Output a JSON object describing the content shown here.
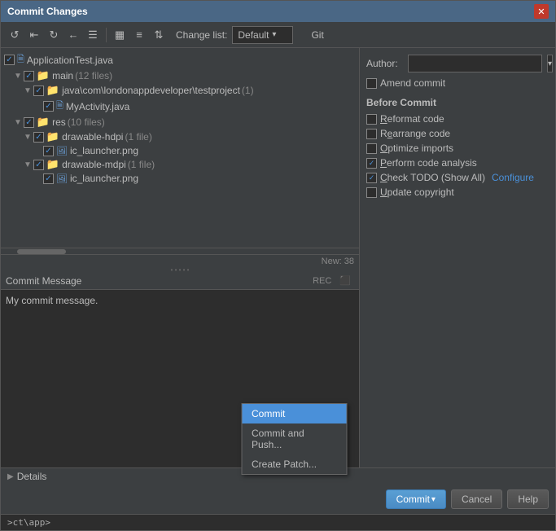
{
  "dialog": {
    "title": "Commit Changes"
  },
  "toolbar": {
    "changelist_label": "Change list:",
    "changelist_value": "Default",
    "git_tab": "Git"
  },
  "file_tree": {
    "items": [
      {
        "id": 1,
        "indent": 0,
        "type": "file",
        "checked": true,
        "name": "ApplicationTest.java",
        "count": ""
      },
      {
        "id": 2,
        "indent": 1,
        "type": "folder",
        "checked": true,
        "name": "main",
        "count": "(12 files)",
        "collapsed": false
      },
      {
        "id": 3,
        "indent": 2,
        "type": "folder",
        "checked": true,
        "name": "java\\com\\londonappdeveloper\\testproject",
        "count": "(1)",
        "collapsed": false
      },
      {
        "id": 4,
        "indent": 3,
        "type": "file",
        "checked": true,
        "name": "MyActivity.java",
        "count": ""
      },
      {
        "id": 5,
        "indent": 1,
        "type": "folder",
        "checked": true,
        "name": "res",
        "count": "(10 files)",
        "collapsed": false
      },
      {
        "id": 6,
        "indent": 2,
        "type": "folder",
        "checked": true,
        "name": "drawable-hdpi",
        "count": "(1 file)",
        "collapsed": false
      },
      {
        "id": 7,
        "indent": 3,
        "type": "file",
        "checked": true,
        "name": "ic_launcher.png",
        "count": ""
      },
      {
        "id": 8,
        "indent": 2,
        "type": "folder",
        "checked": true,
        "name": "drawable-mdpi",
        "count": "(1 file)",
        "collapsed": false
      },
      {
        "id": 9,
        "indent": 3,
        "type": "file",
        "checked": true,
        "name": "ic_launcher.png",
        "count": ""
      }
    ],
    "new_count": "New: 38"
  },
  "commit_message": {
    "label": "Commit Message",
    "value": "My commit message."
  },
  "right_panel": {
    "author_label": "Author:",
    "author_value": "",
    "amend_label": "Amend commit",
    "before_commit_title": "Before Commit",
    "options": [
      {
        "label": "Reformat code",
        "checked": false,
        "underline_char": "R"
      },
      {
        "label": "Rearrange code",
        "checked": false,
        "underline_char": "e"
      },
      {
        "label": "Optimize imports",
        "checked": false,
        "underline_char": "O"
      },
      {
        "label": "Perform code analysis",
        "checked": true,
        "underline_char": "P"
      },
      {
        "label": "Check TODO (Show All)",
        "checked": true,
        "underline_char": "C",
        "configure_link": "Configure"
      },
      {
        "label": "Update copyright",
        "checked": false,
        "underline_char": "U"
      }
    ]
  },
  "bottom": {
    "details_label": "Details",
    "commit_btn": "Commit",
    "commit_arrow": "▾",
    "cancel_btn": "Cancel",
    "help_btn": "Help"
  },
  "dropdown": {
    "items": [
      {
        "label": "Commit",
        "active": true
      },
      {
        "label": "Commit and Push...",
        "active": false
      },
      {
        "label": "Create Patch...",
        "active": false
      }
    ]
  },
  "terminal": {
    "text": ">ct\\app>"
  }
}
